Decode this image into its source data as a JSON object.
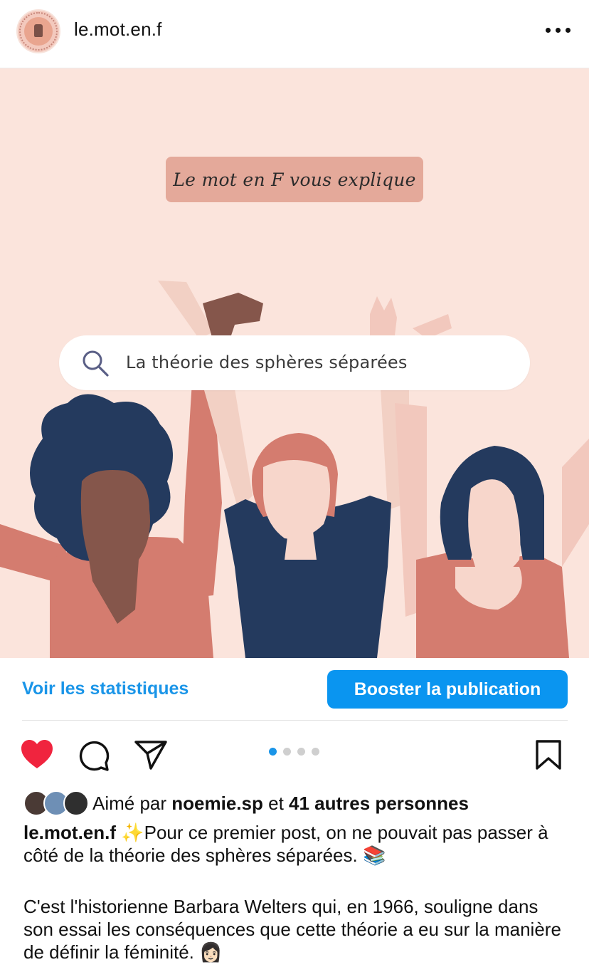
{
  "header": {
    "username": "le.mot.en.f",
    "more_icon": "more-horizontal-icon"
  },
  "post": {
    "headline": "Le mot en F vous explique",
    "search_text": "La théorie des sphères séparées",
    "search_icon": "search-icon",
    "colors": {
      "background": "#fbe4dc",
      "headline_box": "#e4a99a",
      "navy": "#243a5e",
      "coral": "#d47c6f",
      "brown": "#85564b"
    }
  },
  "stats": {
    "link_label": "Voir les statistiques",
    "boost_label": "Booster la publication",
    "accent": "#0a95f0"
  },
  "actions": {
    "like_icon": "heart-filled-icon",
    "comment_icon": "comment-icon",
    "share_icon": "send-icon",
    "save_icon": "bookmark-icon",
    "carousel_total": 4,
    "carousel_active": 1
  },
  "likes": {
    "prefix": "Aimé par",
    "user": "noemie.sp",
    "conj": "et",
    "others": "41 autres personnes"
  },
  "caption": {
    "username": "le.mot.en.f",
    "line1_emoji": "✨",
    "line1": "Pour ce premier post, on ne pouvait pas passer à côté de la théorie des sphères séparées.",
    "line1_end_emoji": "📚",
    "paragraph2": "C'est l'historienne Barbara Welters qui, en 1966, souligne dans son essai les conséquences que cette théorie a eu sur la manière de définir la féminité.",
    "paragraph2_emoji": "👩🏻"
  }
}
